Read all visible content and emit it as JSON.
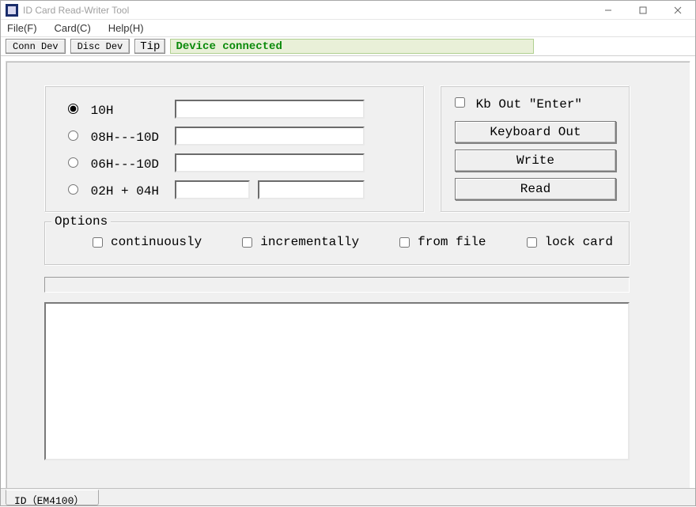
{
  "window": {
    "title": "ID Card Read-Writer Tool"
  },
  "menu": {
    "file": "File(F)",
    "card": "Card(C)",
    "help": "Help(H)"
  },
  "toolbar": {
    "conn": "Conn Dev",
    "disc": "Disc Dev",
    "tip_label": "Tip",
    "tip_text": "Device connected"
  },
  "formats": {
    "r1_label": "10H",
    "r2_label": "08H---10D",
    "r3_label": "06H---10D",
    "r4_label": "02H + 04H",
    "r1_value": "",
    "r2_value": "",
    "r3_value": "",
    "r4a_value": "",
    "r4b_value": ""
  },
  "actions": {
    "kb_enter_label": "Kb Out \"Enter\"",
    "keyboard_out": "Keyboard Out",
    "write": "Write",
    "read": "Read"
  },
  "options": {
    "legend": "Options",
    "continuously": "continuously",
    "incrementally": "incrementally",
    "from_file": "from file",
    "lock_card": "lock card"
  },
  "bottom_tab": "ID（EM4100）"
}
